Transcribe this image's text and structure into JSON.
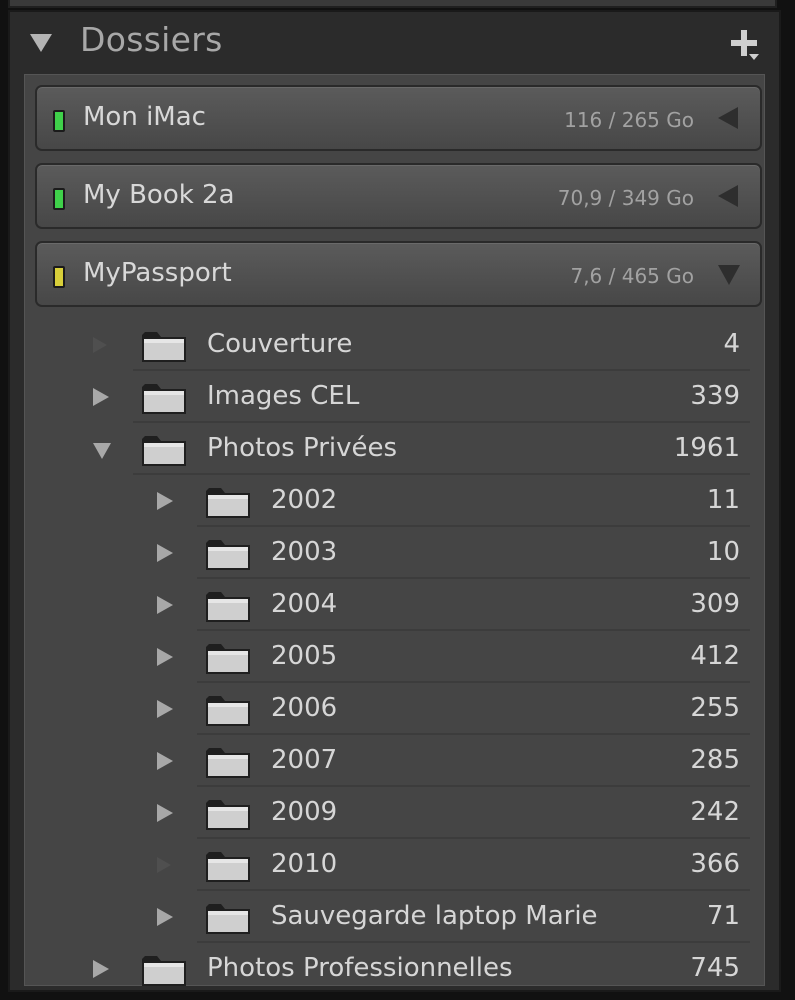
{
  "panel": {
    "title": "Dossiers",
    "add_icon": "plus-dropdown-icon"
  },
  "volumes": [
    {
      "name": "Mon iMac",
      "size": "116 / 265 Go",
      "status_color": "#3fd14a",
      "state": "collapsed"
    },
    {
      "name": "My Book 2a",
      "size": "70,9 / 349 Go",
      "status_color": "#3fd14a",
      "state": "collapsed"
    },
    {
      "name": "MyPassport",
      "size": "7,6 / 465 Go",
      "status_color": "#d8cf3a",
      "state": "expanded"
    }
  ],
  "folders": [
    {
      "name": "Couverture",
      "count": "4",
      "level": 1,
      "state": "empty"
    },
    {
      "name": "Images CEL",
      "count": "339",
      "level": 1,
      "state": "collapsed"
    },
    {
      "name": "Photos Privées",
      "count": "1961",
      "level": 1,
      "state": "expanded"
    },
    {
      "name": "2002",
      "count": "11",
      "level": 2,
      "state": "collapsed"
    },
    {
      "name": "2003",
      "count": "10",
      "level": 2,
      "state": "collapsed"
    },
    {
      "name": "2004",
      "count": "309",
      "level": 2,
      "state": "collapsed"
    },
    {
      "name": "2005",
      "count": "412",
      "level": 2,
      "state": "collapsed"
    },
    {
      "name": "2006",
      "count": "255",
      "level": 2,
      "state": "collapsed"
    },
    {
      "name": "2007",
      "count": "285",
      "level": 2,
      "state": "collapsed"
    },
    {
      "name": "2009",
      "count": "242",
      "level": 2,
      "state": "collapsed"
    },
    {
      "name": "2010",
      "count": "366",
      "level": 2,
      "state": "empty"
    },
    {
      "name": "Sauvegarde laptop Marie",
      "count": "71",
      "level": 2,
      "state": "collapsed"
    },
    {
      "name": "Photos Professionnelles",
      "count": "745",
      "level": 1,
      "state": "collapsed"
    }
  ],
  "colors": {
    "panel_bg": "#2b2b2b",
    "content_bg": "#454545",
    "text": "#d6d6d6",
    "muted_text": "#a2a2a2"
  }
}
